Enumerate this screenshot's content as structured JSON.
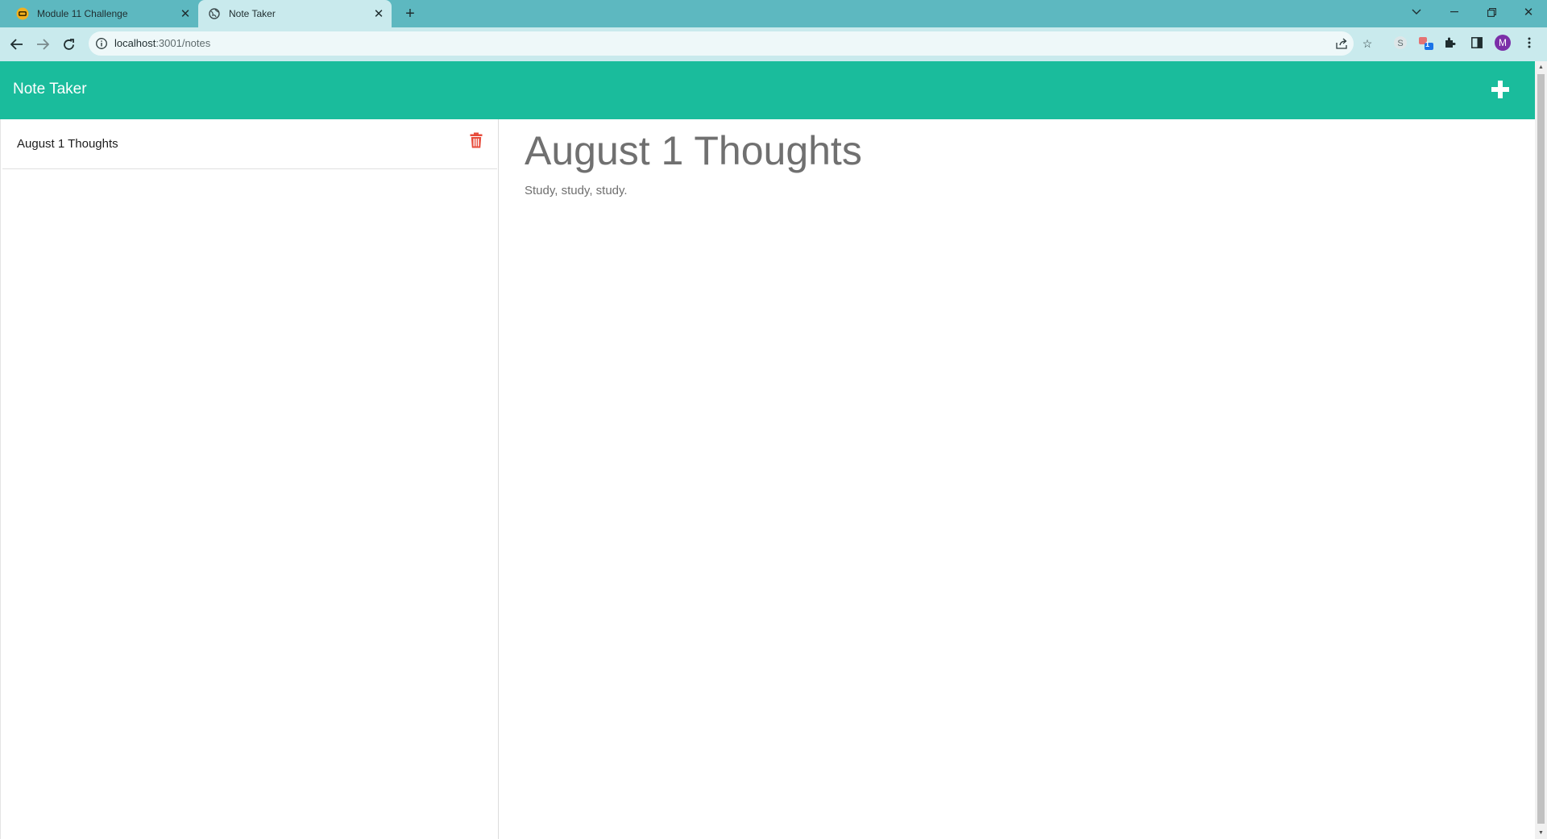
{
  "browser": {
    "tabs": [
      {
        "title": "Module 11 Challenge",
        "active": false,
        "favicon": "module-favicon-icon"
      },
      {
        "title": "Note Taker",
        "active": true,
        "favicon": "globe-icon"
      }
    ],
    "url_host": "localhost",
    "url_path": ":3001/notes",
    "profile_initial": "M",
    "extension_badge": "1"
  },
  "app": {
    "title": "Note Taker",
    "accent_color": "#1abc9c",
    "delete_color": "#e74c3c"
  },
  "sidebar": {
    "notes": [
      {
        "title": "August 1 Thoughts"
      }
    ]
  },
  "editor": {
    "title": "August 1 Thoughts",
    "body": "Study, study, study."
  }
}
